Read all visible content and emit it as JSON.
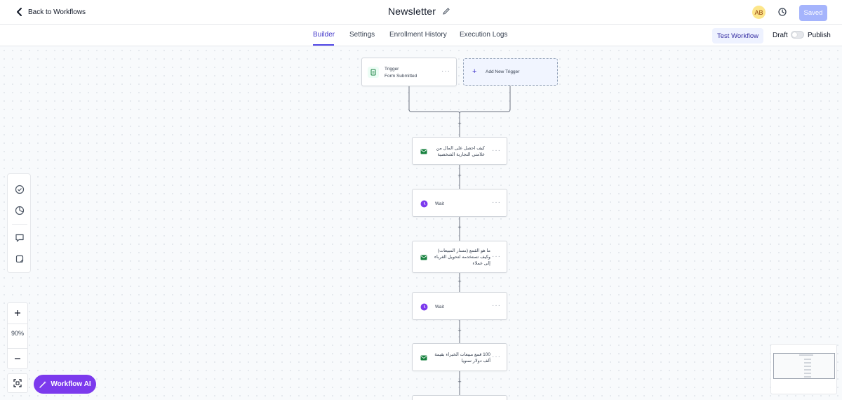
{
  "header": {
    "back_label": "Back to Workflows",
    "title": "Newsletter",
    "avatar_initials": "AB",
    "saved_label": "Saved"
  },
  "tabs": [
    {
      "label": "Builder",
      "active": true
    },
    {
      "label": "Settings",
      "active": false
    },
    {
      "label": "Enrollment History",
      "active": false
    },
    {
      "label": "Execution Logs",
      "active": false
    }
  ],
  "toolbar": {
    "test_label": "Test Workflow",
    "draft_label": "Draft",
    "publish_label": "Publish",
    "published": false
  },
  "trigger": {
    "title": "Trigger",
    "subtitle": "Form Submitted",
    "add_label": "Add New Trigger"
  },
  "steps": [
    {
      "type": "email",
      "text": "كيف احصل على المال من علامتي التجارية الشخصية"
    },
    {
      "type": "wait",
      "text": "Wait"
    },
    {
      "type": "email",
      "text": "ما هو القمع (مسار المبيعات) وكيف تستخدمه لتحويل الغرباء إلى عملاء"
    },
    {
      "type": "wait",
      "text": "Wait"
    },
    {
      "type": "email",
      "text": "100 قمع مبيعات الخبراء بقيمة ألف دولار سنويا"
    }
  ],
  "plus_symbol": "+",
  "menu_dots": "···",
  "zoom": {
    "level": "90%"
  },
  "ai_button": {
    "label": "Workflow AI"
  },
  "colors": {
    "accent": "#4f46e5",
    "email_icon": "#15803d",
    "wait_icon": "#7c3aed",
    "ai_button": "#7c3aed"
  }
}
